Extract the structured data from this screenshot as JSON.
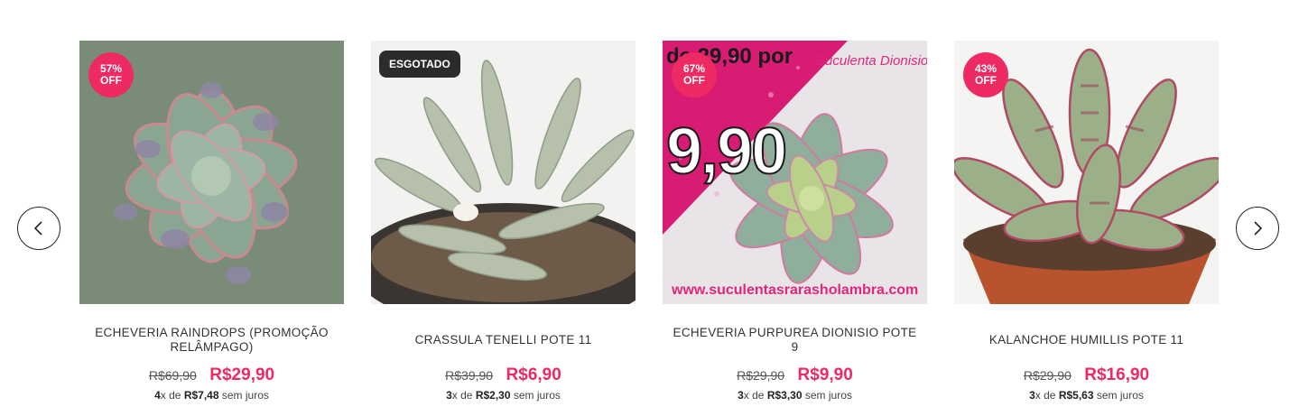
{
  "carousel": {
    "prev_icon": "chevron-left-icon",
    "next_icon": "chevron-right-icon"
  },
  "products": [
    {
      "name": "ECHEVERIA RAINDROPS (PROMOÇÃO RELÂMPAGO)",
      "badge_pct": "57%",
      "badge_off": "OFF",
      "old_price": "R$69,90",
      "new_price": "R$29,90",
      "inst_n": "4",
      "inst_x": "x de ",
      "inst_val": "R$7,48",
      "inst_suffix": " sem juros"
    },
    {
      "name": "CRASSULA TENELLI POTE 11",
      "badge_soldout": "ESGOTADO",
      "old_price": "R$39,90",
      "new_price": "R$6,90",
      "inst_n": "3",
      "inst_x": "x de ",
      "inst_val": "R$2,30",
      "inst_suffix": " sem juros"
    },
    {
      "name": "ECHEVERIA PURPUREA DIONISIO POTE 9",
      "badge_pct": "67%",
      "badge_off": "OFF",
      "image_text": {
        "top": "de 29,90 por",
        "big": "9,90",
        "brand": "Suculenta Dionisio",
        "url": "www.suculentasrarasholambra.com"
      },
      "old_price": "R$29,90",
      "new_price": "R$9,90",
      "inst_n": "3",
      "inst_x": "x de ",
      "inst_val": "R$3,30",
      "inst_suffix": " sem juros"
    },
    {
      "name": "KALANCHOE HUMILLIS POTE 11",
      "badge_pct": "43%",
      "badge_off": "OFF",
      "old_price": "R$29,90",
      "new_price": "R$16,90",
      "inst_n": "3",
      "inst_x": "x de ",
      "inst_val": "R$5,63",
      "inst_suffix": " sem juros"
    }
  ],
  "colors": {
    "accent": "#ee2a62",
    "soldout_badge": "#2b2b2b"
  }
}
